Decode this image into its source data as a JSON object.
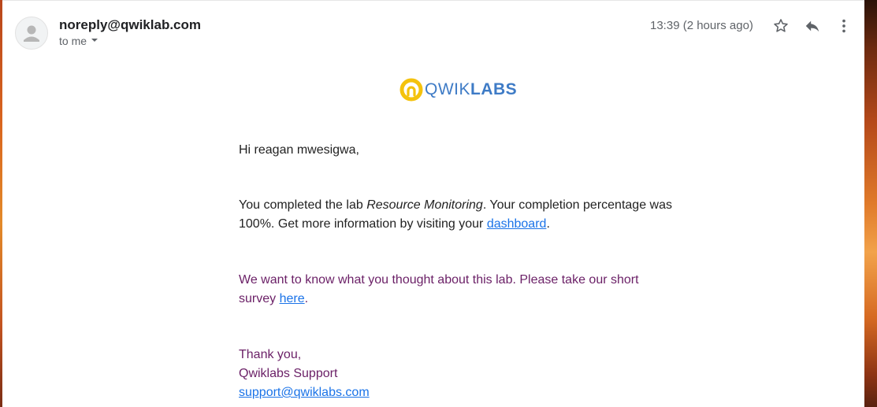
{
  "header": {
    "sender": "noreply@qwiklab.com",
    "recipient_label": "to me",
    "timestamp": "13:39 (2 hours ago)",
    "icons": [
      "star-icon",
      "reply-icon",
      "more-vert-icon"
    ]
  },
  "logo": {
    "text_light": "QWIK",
    "text_bold": "LABS"
  },
  "message": {
    "greeting": "Hi reagan mwesigwa,",
    "para1": {
      "prefix": "You completed the lab ",
      "lab_name": "Resource Monitoring",
      "suffix": ". Your completion percentage was",
      "line2_prefix": "100%. Get more information by visiting your ",
      "link_text": "dashboard",
      "line2_suffix": "."
    },
    "para2": {
      "line1": "We want to know what you thought about this lab. Please take our short",
      "line2_prefix": "survey ",
      "link_text": "here",
      "line2_suffix": "."
    },
    "signoff": {
      "thanks": "Thank you,",
      "team": "Qwiklabs Support",
      "email_link": "support@qwiklabs.com"
    }
  },
  "colors": {
    "brand_blue": "#3e7bc6",
    "brand_yellow": "#f4c20d",
    "link": "#1a73e8",
    "purple_text": "#6a1f66"
  }
}
